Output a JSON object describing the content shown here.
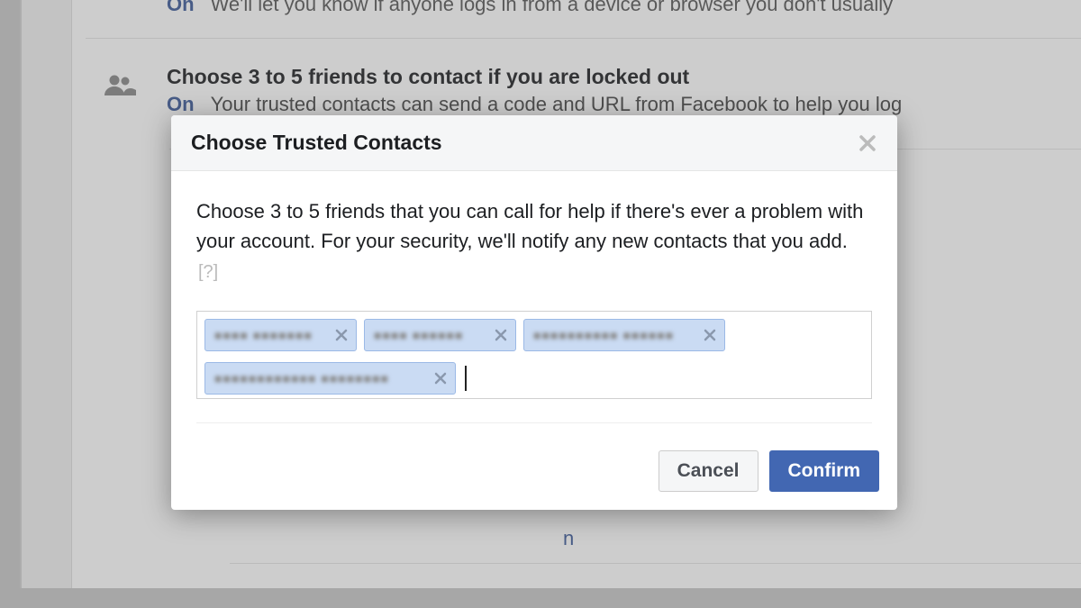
{
  "background": {
    "row1": {
      "status": "On",
      "text_fragment": "We'll let you know if anyone logs in from a device or browser you don't usually"
    },
    "row2": {
      "heading": "Choose 3 to 5 friends to contact if you are locked out",
      "status": "On",
      "sub_fragment": "Your trusted contacts can send a code and URL from Facebook to help you log"
    },
    "stray_char": "n"
  },
  "modal": {
    "title": "Choose Trusted Contacts",
    "description": "Choose 3 to 5 friends that you can call for help if there's ever a problem with your account. For your security, we'll notify any new contacts that you add.",
    "help_label": "[?]",
    "tokens": [
      {
        "label": "■■■■  ■■■■■■■"
      },
      {
        "label": "■■■■  ■■■■■■"
      },
      {
        "label": "■■■■■■■■■■  ■■■■■■"
      },
      {
        "label": "■■■■■■■■■■■■  ■■■■■■■■"
      }
    ],
    "buttons": {
      "cancel": "Cancel",
      "confirm": "Confirm"
    }
  }
}
